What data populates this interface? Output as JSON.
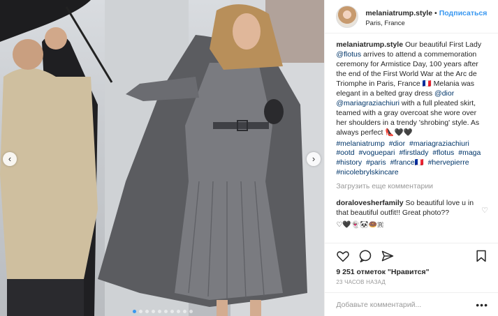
{
  "colors": {
    "link": "#003569",
    "accent": "#3897f0",
    "muted": "#999999",
    "text": "#262626"
  },
  "photo": {
    "prev_icon": "chevron-left-icon",
    "next_icon": "chevron-right-icon",
    "prev_glyph": "‹",
    "next_glyph": "›",
    "dots_total": 10,
    "dots_active": 1
  },
  "header": {
    "username": "melaniatrump.style",
    "separator": "•",
    "follow_label": "Подписаться",
    "location": "Paris, France"
  },
  "caption": {
    "username": "melaniatrump.style",
    "t1": " Our beautiful First Lady ",
    "m1": "@flotus",
    "t2": " arrives to attend a commemoration ceremony for Armistice Day, 100 years after the end of the First World War at the Arc de Triomphe in Paris, France 🇫🇷 Melania was elegant in a belted gray dress ",
    "m2": "@dior",
    "t3": " ",
    "m3": "@mariagraziachiuri",
    "t4": " with a full pleated skirt, teamed with a gray overcoat she wore over her shoulders in a trendy 'shrobing' style. As always perfect 👠🖤🖤",
    "hashtags": [
      "#melaniatrump",
      "#dior",
      "#mariagraziachiuri",
      "#ootd",
      "#voguepari",
      "#firstlady",
      "#flotus",
      "#maga",
      "#history",
      "#paris",
      "#france🇫🇷",
      "#hervepierre",
      "#nicolebrylskincare"
    ]
  },
  "load_more": "Загрузить еще комментарии",
  "comment": {
    "username": "doralovesherfamily",
    "text": " So beautiful love u in that beautiful outfit!! Great photo??",
    "reply": "♡🖤👻🐼🍩🇷"
  },
  "actions": {
    "like_icon": "heart-icon",
    "comment_icon": "comment-icon",
    "share_icon": "share-icon",
    "save_icon": "bookmark-icon"
  },
  "likes": "9 251 отметок \"Нравится\"",
  "time": "23 часов назад",
  "add_comment": {
    "placeholder": "Добавьте комментарий...",
    "more": "•••"
  }
}
